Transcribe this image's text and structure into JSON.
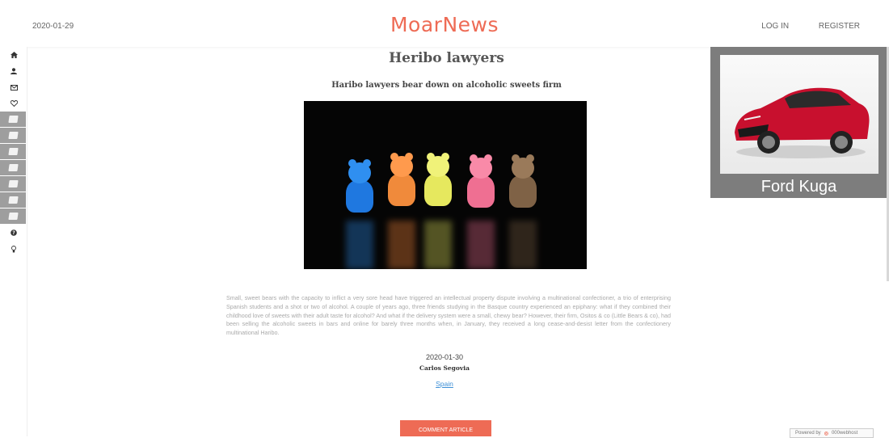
{
  "header": {
    "date": "2020-01-29",
    "logo": "MoarNews",
    "login": "LOG IN",
    "register": "REGISTER"
  },
  "sidebar": {
    "top_icons": [
      "home-icon",
      "user-icon",
      "mail-icon",
      "heart-icon"
    ],
    "category_count_note": "",
    "bottom_icons": [
      "help-icon",
      "bulb-icon"
    ]
  },
  "article": {
    "title": "Heribo lawyers",
    "subtitle": "Haribo lawyers bear down on alcoholic sweets firm",
    "body": "Small, sweet bears with the capacity to inflict a very sore head have triggered an intellectual property dispute involving a multinational confectioner, a trio of enterprising Spanish students and a shot or two of alcohol. A couple of years ago, three friends studying in the Basque country experienced an epiphany: what if they combined their childhood love of sweets with their adult taste for alcohol? And what if the delivery system were a small, chewy bear? However, their firm, Ositos & co (Little Bears & co), had been selling the alcoholic sweets in bars and online for barely three months when, in January, they received a long cease-and-desist letter from the confectionery multinational Haribo.",
    "date": "2020-01-30",
    "author": "Carlos Segovia",
    "category": "Spain",
    "comment_button": "COMMENT ARTICLE"
  },
  "ad": {
    "label": "Ford Kuga"
  },
  "footer": {
    "powered_by": "Powered by",
    "host": "000webhost"
  },
  "colors": {
    "accent": "#ee6b55",
    "link": "#3d8fd6",
    "ad_bg": "#7d7d7d"
  }
}
